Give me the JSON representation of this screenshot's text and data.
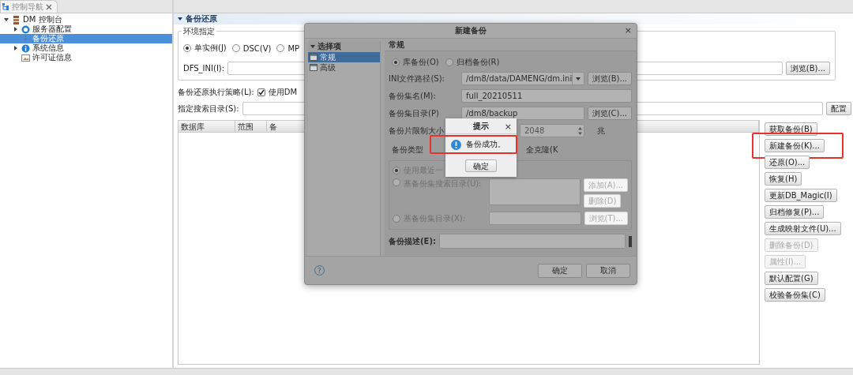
{
  "nav": {
    "tab": {
      "label": "控制导航"
    },
    "tree": [
      {
        "label": "DM 控制台",
        "kind": "console",
        "expanded": true,
        "selected": false,
        "children": [
          {
            "label": "服务器配置",
            "kind": "config",
            "expanded": false,
            "selected": false
          },
          {
            "label": "备份还原",
            "kind": "backup",
            "selected": true
          },
          {
            "label": "系统信息",
            "kind": "info",
            "expanded": false,
            "selected": false
          },
          {
            "label": "许可证信息",
            "kind": "license",
            "selected": false
          }
        ]
      }
    ]
  },
  "panel": {
    "title": "备份还原",
    "environment": {
      "title": "环境指定",
      "modes": [
        {
          "label": "单实例(J)",
          "selected": true
        },
        {
          "label": "DSC(V)",
          "selected": false
        },
        {
          "label": "MP",
          "selected": false
        }
      ],
      "dfs_label": "DFS_INI(I):",
      "browse_button": "浏览(B)..."
    },
    "strategy": {
      "label": "备份还原执行策略(L):",
      "option": "使用DM",
      "checked": true
    },
    "search": {
      "label": "指定搜索目录(S):",
      "button": "配置"
    },
    "table": {
      "columns": [
        "数据库",
        "范围",
        "备"
      ]
    },
    "actions": [
      {
        "label": "获取备份(B)",
        "disabled": false,
        "highlighted": false
      },
      {
        "label": "新建备份(K)...",
        "disabled": false,
        "highlighted": true
      },
      {
        "label": "还原(O)...",
        "disabled": false,
        "highlighted": false
      },
      {
        "label": "恢复(H)",
        "disabled": false,
        "highlighted": false
      },
      {
        "label": "更新DB_Magic(I)",
        "disabled": false,
        "highlighted": false
      },
      {
        "label": "归档修复(P)...",
        "disabled": false,
        "highlighted": false
      },
      {
        "label": "生成映射文件(U)...",
        "disabled": false,
        "highlighted": false
      },
      {
        "label": "删除备份(D)",
        "disabled": true,
        "highlighted": false
      },
      {
        "label": "属性(I)...",
        "disabled": true,
        "highlighted": false
      },
      {
        "label": "默认配置(G)",
        "disabled": false,
        "highlighted": false
      },
      {
        "label": "校验备份集(C)",
        "disabled": false,
        "highlighted": false
      }
    ]
  },
  "dialog": {
    "title": "新建备份",
    "close": "×",
    "options_title": "选择项",
    "options": [
      {
        "label": "常规",
        "selected": true
      },
      {
        "label": "高级",
        "selected": false
      }
    ],
    "section": "常规",
    "types": [
      {
        "label": "库备份(O)",
        "selected": true
      },
      {
        "label": "归档备份(R)",
        "selected": false
      }
    ],
    "fields": [
      {
        "label": "INI文件路径(S):",
        "value": "/dm8/data/DAMENG/dm.ini",
        "kind": "combo",
        "button": "浏览(B)..."
      },
      {
        "label": "备份集名(M):",
        "value": "full_20210511",
        "kind": "text"
      },
      {
        "label": "备份集目录(P)",
        "value": "/dm8/backup",
        "kind": "text",
        "button": "浏览(C)..."
      }
    ],
    "limit": {
      "label": "备份片限制大小",
      "value": "2048",
      "unit": "兆"
    },
    "backup_type": {
      "label": "备份类型",
      "option": "全克隆(K"
    },
    "base": {
      "disabled": true,
      "options": [
        {
          "label": "使用最近一",
          "selected": true
        },
        {
          "label": "基备份集搜索目录(U):",
          "selected": false
        },
        {
          "label": "基备份集目录(X):",
          "selected": false
        }
      ],
      "add_button": "添加(A)...",
      "delete_button": "删除(D)",
      "browse_button": "浏览(T)..."
    },
    "description_label": "备份描述(E):",
    "help": "?",
    "ok_button": "确定",
    "cancel_button": "取消"
  },
  "message": {
    "title": "提示",
    "close": "×",
    "text": "备份成功。",
    "highlighted": true,
    "ok_button": "确定"
  }
}
